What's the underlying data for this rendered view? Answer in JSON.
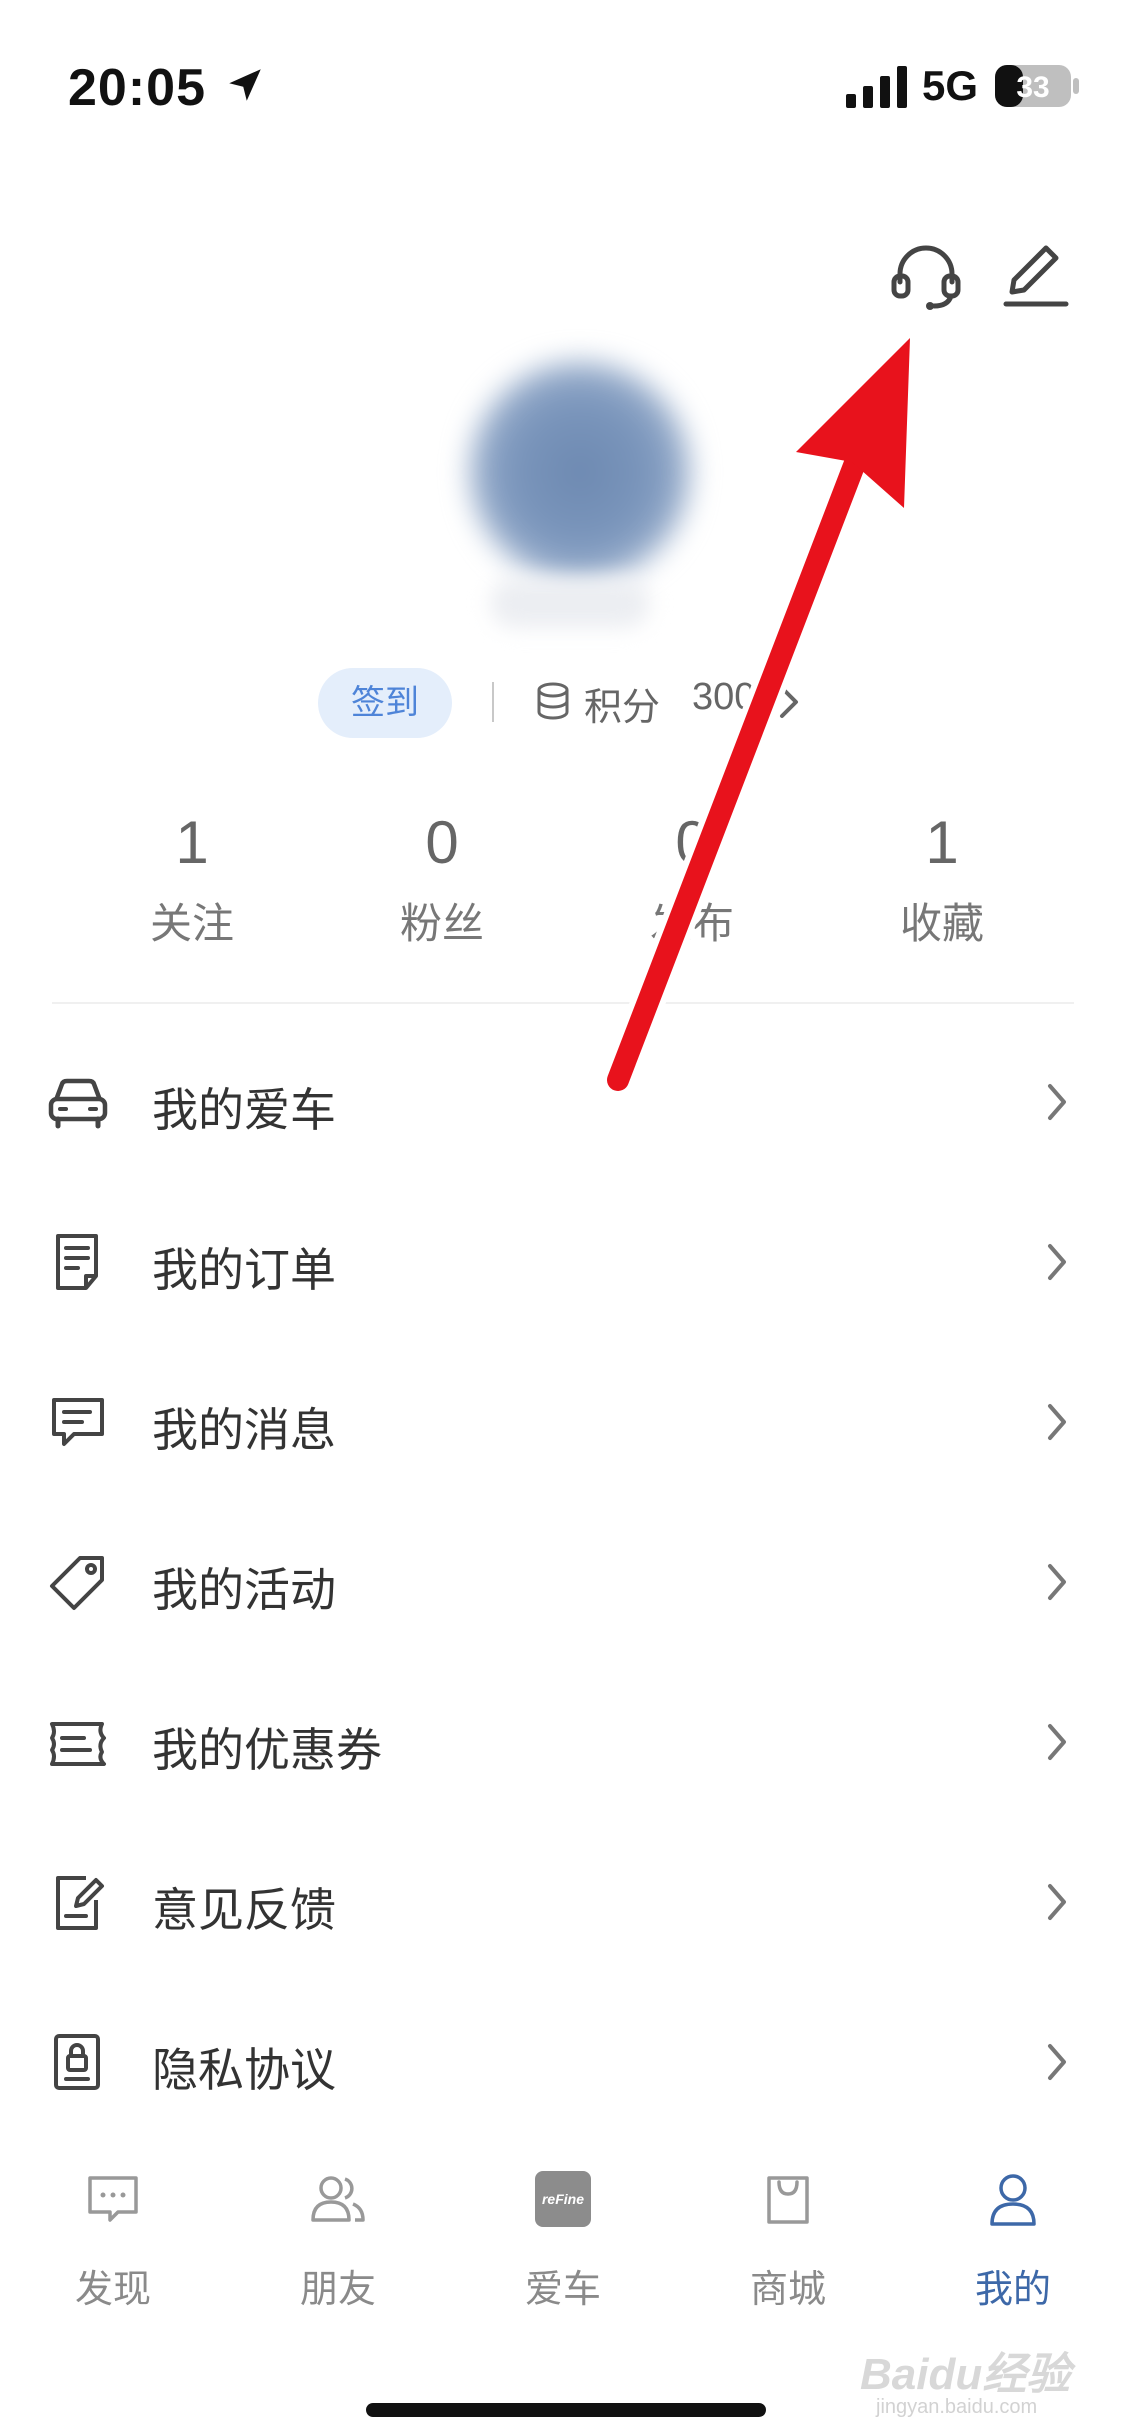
{
  "status_bar": {
    "time": "20:05",
    "network": "5G",
    "battery": "33"
  },
  "header": {
    "support_icon": "headset-icon",
    "edit_icon": "edit-pencil-icon"
  },
  "profile": {
    "signin_label": "签到",
    "points_label": "积分",
    "points_value": "300"
  },
  "stats": [
    {
      "value": "1",
      "label": "关注"
    },
    {
      "value": "0",
      "label": "粉丝"
    },
    {
      "value": "0",
      "label": "发布"
    },
    {
      "value": "1",
      "label": "收藏"
    }
  ],
  "menu": [
    {
      "label": "我的爱车",
      "icon": "car-icon"
    },
    {
      "label": "我的订单",
      "icon": "order-icon"
    },
    {
      "label": "我的消息",
      "icon": "message-icon"
    },
    {
      "label": "我的活动",
      "icon": "tag-icon"
    },
    {
      "label": "我的优惠券",
      "icon": "coupon-icon"
    },
    {
      "label": "意见反馈",
      "icon": "feedback-icon"
    },
    {
      "label": "隐私协议",
      "icon": "privacy-icon"
    }
  ],
  "tabs": [
    {
      "label": "发现",
      "icon": "discover-icon",
      "active": false
    },
    {
      "label": "朋友",
      "icon": "friends-icon",
      "active": false
    },
    {
      "label": "爱车",
      "icon": "refine-logo-icon",
      "active": false
    },
    {
      "label": "商城",
      "icon": "shop-bag-icon",
      "active": false
    },
    {
      "label": "我的",
      "icon": "profile-icon",
      "active": true
    }
  ],
  "colors": {
    "accent": "#3d68a8",
    "signin_bg": "#e4eefb",
    "signin_text": "#4e84d8",
    "annotation": "#e8121c"
  },
  "watermark": {
    "text": "Baidu经验",
    "sub": "jingyan.baidu.com"
  }
}
